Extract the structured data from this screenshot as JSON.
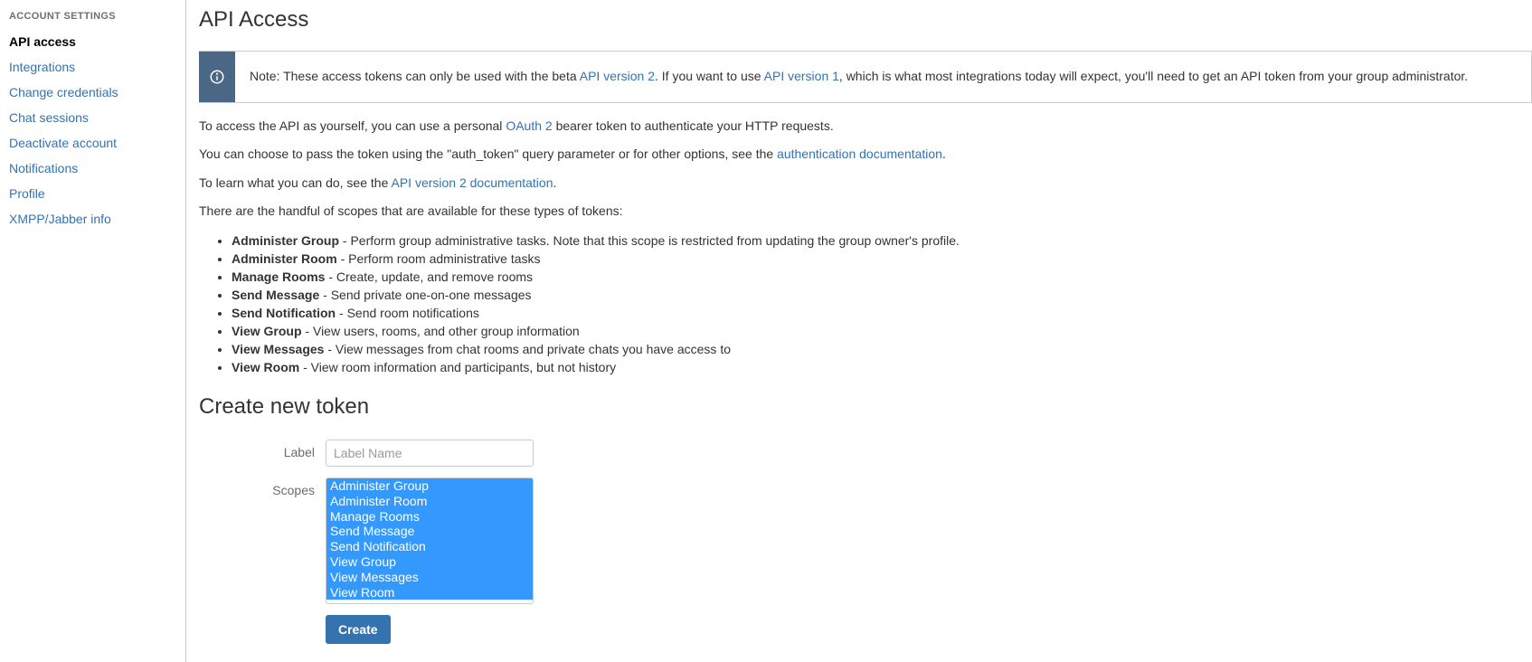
{
  "sidebar": {
    "heading": "ACCOUNT SETTINGS",
    "items": [
      {
        "label": "API access",
        "key": "api-access"
      },
      {
        "label": "Integrations",
        "key": "integrations"
      },
      {
        "label": "Change credentials",
        "key": "change-credentials"
      },
      {
        "label": "Chat sessions",
        "key": "chat-sessions"
      },
      {
        "label": "Deactivate account",
        "key": "deactivate-account"
      },
      {
        "label": "Notifications",
        "key": "notifications"
      },
      {
        "label": "Profile",
        "key": "profile"
      },
      {
        "label": "XMPP/Jabber info",
        "key": "xmpp-jabber"
      }
    ]
  },
  "page": {
    "title": "API Access",
    "note_prefix": "Note: These access tokens can only be used with the beta ",
    "note_link1": "API version 2",
    "note_mid1": ". If you want to use ",
    "note_link2": "API version 1",
    "note_mid2": ", which is what most integrations today will expect, you'll need to get an API token from your group administrator.",
    "para1_pre": "To access the API as yourself, you can use a personal ",
    "para1_link": "OAuth 2",
    "para1_post": " bearer token to authenticate your HTTP requests.",
    "para2_pre": "You can choose to pass the token using the \"auth_token\" query parameter or for other options, see the ",
    "para2_link": "authentication documentation",
    "para2_post": ".",
    "para3_pre": "To learn what you can do, see the ",
    "para3_link": "API version 2 documentation",
    "para3_post": ".",
    "para4": "There are the handful of scopes that are available for these types of tokens:"
  },
  "scopes_desc": [
    {
      "name": "Administer Group",
      "desc": " - Perform group administrative tasks. Note that this scope is restricted from updating the group owner's profile."
    },
    {
      "name": "Administer Room",
      "desc": " - Perform room administrative tasks"
    },
    {
      "name": "Manage Rooms",
      "desc": " - Create, update, and remove rooms"
    },
    {
      "name": "Send Message",
      "desc": " - Send private one-on-one messages"
    },
    {
      "name": "Send Notification",
      "desc": " - Send room notifications"
    },
    {
      "name": "View Group",
      "desc": " - View users, rooms, and other group information"
    },
    {
      "name": "View Messages",
      "desc": " - View messages from chat rooms and private chats you have access to"
    },
    {
      "name": "View Room",
      "desc": " - View room information and participants, but not history"
    }
  ],
  "form": {
    "section_title": "Create new token",
    "label_label": "Label",
    "label_placeholder": "Label Name",
    "scopes_label": "Scopes",
    "scope_options": [
      "Administer Group",
      "Administer Room",
      "Manage Rooms",
      "Send Message",
      "Send Notification",
      "View Group",
      "View Messages",
      "View Room"
    ],
    "create_button": "Create"
  }
}
